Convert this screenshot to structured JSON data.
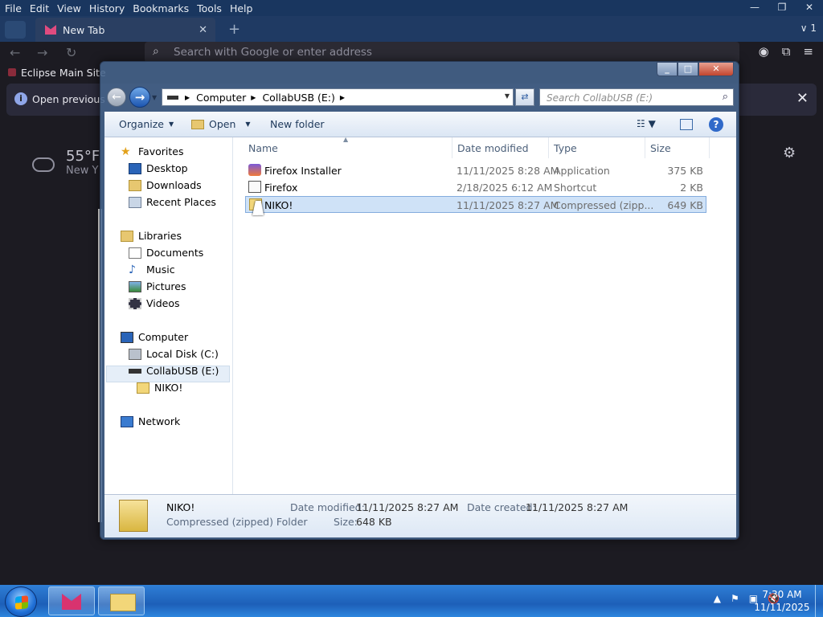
{
  "firefox": {
    "menu": [
      "File",
      "Edit",
      "View",
      "History",
      "Bookmarks",
      "Tools",
      "Help"
    ],
    "tab_title": "New Tab",
    "tab_count": "1",
    "url_placeholder": "Search with Google or enter address",
    "bookmark": "Eclipse Main Site",
    "notice": "Open previous",
    "weather_temp": "55°F",
    "weather_loc": "New Y"
  },
  "explorer": {
    "breadcrumb": [
      "Computer",
      "CollabUSB (E:)"
    ],
    "search_placeholder": "Search CollabUSB (E:)",
    "toolbar": {
      "organize": "Organize",
      "open": "Open",
      "new_folder": "New folder"
    },
    "nav": {
      "favorites": "Favorites",
      "desktop": "Desktop",
      "downloads": "Downloads",
      "recent": "Recent Places",
      "libraries": "Libraries",
      "documents": "Documents",
      "music": "Music",
      "pictures": "Pictures",
      "videos": "Videos",
      "computer": "Computer",
      "local_disk": "Local Disk (C:)",
      "usb": "CollabUSB (E:)",
      "niko": "NIKO!",
      "network": "Network"
    },
    "columns": [
      "Name",
      "Date modified",
      "Type",
      "Size"
    ],
    "files": [
      {
        "name": "Firefox Installer",
        "date": "11/11/2025 8:28 AM",
        "type": "Application",
        "size": "375 KB"
      },
      {
        "name": "Firefox",
        "date": "2/18/2025 6:12 AM",
        "type": "Shortcut",
        "size": "2 KB"
      },
      {
        "name": "NIKO!",
        "date": "11/11/2025 8:27 AM",
        "type": "Compressed (zipp...",
        "size": "649 KB"
      }
    ],
    "details": {
      "name": "NIKO!",
      "kind": "Compressed (zipped) Folder",
      "date_modified_label": "Date modified:",
      "date_modified": "11/11/2025 8:27 AM",
      "size_label": "Size:",
      "size": "648 KB",
      "date_created_label": "Date created:",
      "date_created": "11/11/2025 8:27 AM"
    }
  },
  "taskbar": {
    "time": "7:30 AM",
    "date": "11/11/2025"
  }
}
